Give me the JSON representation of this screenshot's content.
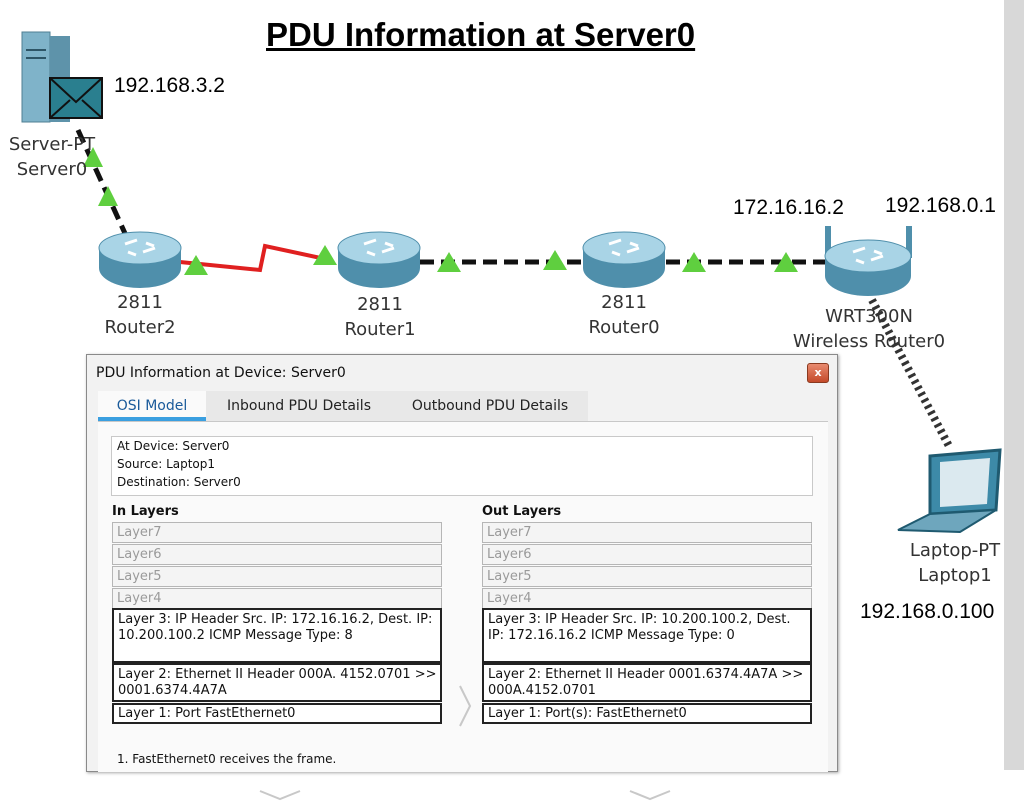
{
  "slide": {
    "title": "PDU Information at Server0"
  },
  "topology": {
    "devices": [
      {
        "id": "server",
        "icon": "server-icon",
        "label1": "Server-PT",
        "label2": "Server0"
      },
      {
        "id": "router2",
        "icon": "router-icon",
        "label1": "2811",
        "label2": "Router2"
      },
      {
        "id": "router1",
        "icon": "router-icon",
        "label1": "2811",
        "label2": "Router1"
      },
      {
        "id": "router0",
        "icon": "router-icon",
        "label1": "2811",
        "label2": "Router0"
      },
      {
        "id": "wrouter",
        "icon": "wireless-router-icon",
        "label1": "WRT300N",
        "label2": "Wireless Router0"
      },
      {
        "id": "laptop",
        "icon": "laptop-icon",
        "label1": "Laptop-PT",
        "label2": "Laptop1"
      }
    ],
    "ips": {
      "server": "192.168.3.2",
      "router0": "172.16.16.2",
      "wrouter": "192.168.0.1",
      "laptop": "192.168.0.100"
    },
    "colors": {
      "serial_link": "#e02020",
      "ethernet_link": "#111111",
      "link_up": "#5fcf3f"
    }
  },
  "dialog": {
    "title": "PDU Information at Device: Server0",
    "close_label": "x",
    "tabs": [
      "OSI Model",
      "Inbound PDU Details",
      "Outbound PDU Details"
    ],
    "active_tab": "OSI Model",
    "info": {
      "device": "At Device: Server0",
      "source": "Source: Laptop1",
      "destination": "Destination: Server0"
    },
    "in_header": "In Layers",
    "out_header": "Out Layers",
    "in_layers": [
      {
        "text": "Layer7",
        "active": false
      },
      {
        "text": "Layer6",
        "active": false
      },
      {
        "text": "Layer5",
        "active": false
      },
      {
        "text": "Layer4",
        "active": false
      },
      {
        "text": "Layer 3: IP Header Src. IP: 172.16.16.2, Dest. IP: 10.200.100.2 ICMP Message Type: 8",
        "active": true
      },
      {
        "text": "Layer 2: Ethernet II Header 000A. 4152.0701 >> 0001.6374.4A7A",
        "active": true
      },
      {
        "text": "Layer 1: Port FastEthernet0",
        "active": true
      }
    ],
    "out_layers": [
      {
        "text": "Layer7",
        "active": false
      },
      {
        "text": "Layer6",
        "active": false
      },
      {
        "text": "Layer5",
        "active": false
      },
      {
        "text": "Layer4",
        "active": false
      },
      {
        "text": "Layer 3: IP Header Src. IP: 10.200.100.2, Dest. IP: 172.16.16.2 ICMP Message Type: 0",
        "active": true
      },
      {
        "text": "Layer 2: Ethernet II Header 0001.6374.4A7A >> 000A.4152.0701",
        "active": true
      },
      {
        "text": "Layer 1: Port(s): FastEthernet0",
        "active": true
      }
    ],
    "steps": [
      "1. FastEthernet0 receives the frame."
    ]
  }
}
